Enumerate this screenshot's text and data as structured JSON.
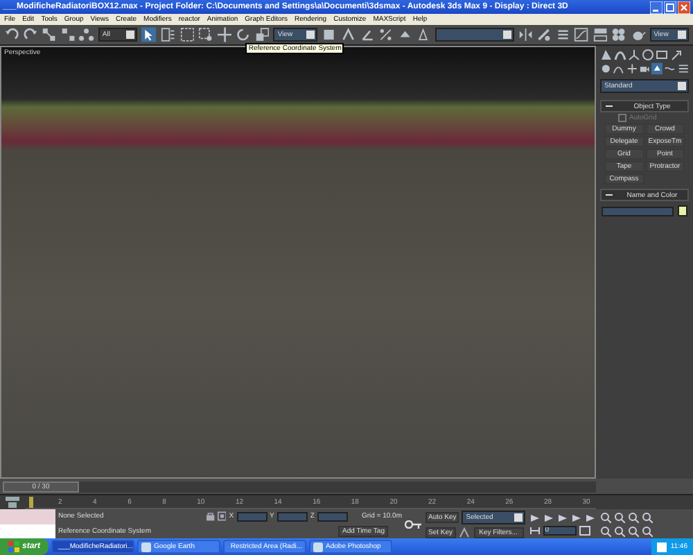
{
  "window": {
    "title": "___ModificheRadiatoriBOX12.max    - Project Folder: C:\\Documents and Settings\\a\\Documenti\\3dsmax    - Autodesk 3ds Max 9    - Display : Direct 3D"
  },
  "menu": [
    "File",
    "Edit",
    "Tools",
    "Group",
    "Views",
    "Create",
    "Modifiers",
    "reactor",
    "Animation",
    "Graph Editors",
    "Rendering",
    "Customize",
    "MAXScript",
    "Help"
  ],
  "toolbar": {
    "selection_filter": "All",
    "coordinate_system": "View",
    "right_dropdown": "View",
    "tooltip": "Reference Coordinate System"
  },
  "viewport": {
    "label": "Perspective"
  },
  "command_panel": {
    "category": "Standard",
    "rollouts": [
      {
        "title": "Object Type",
        "expanded": true
      },
      {
        "title": "Name and Color",
        "expanded": true
      }
    ],
    "autogrid": {
      "label": "AutoGrid",
      "checked": false,
      "disabled": true
    },
    "buttons": [
      "Dummy",
      "Crowd",
      "Delegate",
      "ExposeTm",
      "Grid",
      "Point",
      "Tape",
      "Protractor",
      "Compass"
    ]
  },
  "time_slider": {
    "label": "0 / 30",
    "level": 0
  },
  "track_ticks": [
    "2",
    "4",
    "6",
    "8",
    "10",
    "12",
    "14",
    "16",
    "18",
    "20",
    "22",
    "24",
    "26",
    "28",
    "30"
  ],
  "status": {
    "selection": "None Selected",
    "prompt": "Reference Coordinate System",
    "coords": [
      {
        "axis": "X"
      },
      {
        "axis": "Y"
      },
      {
        "axis": "Z"
      }
    ],
    "grid": "Grid = 10.0m",
    "time_tag": "Add Time Tag"
  },
  "animation": {
    "auto_key": "Auto Key",
    "key_mode": "Selected",
    "set_key": "Set Key",
    "key_filters": "Key Filters...",
    "frame": "0"
  },
  "taskbar": {
    "start": "start",
    "tasks": [
      {
        "label": "___ModificheRadiatori...",
        "selected": true
      },
      {
        "label": "Google Earth",
        "selected": false
      },
      {
        "label": "Restricted Area (Radi...",
        "selected": false
      },
      {
        "label": "Adobe Photoshop",
        "selected": false
      }
    ],
    "clock": "11:46"
  }
}
